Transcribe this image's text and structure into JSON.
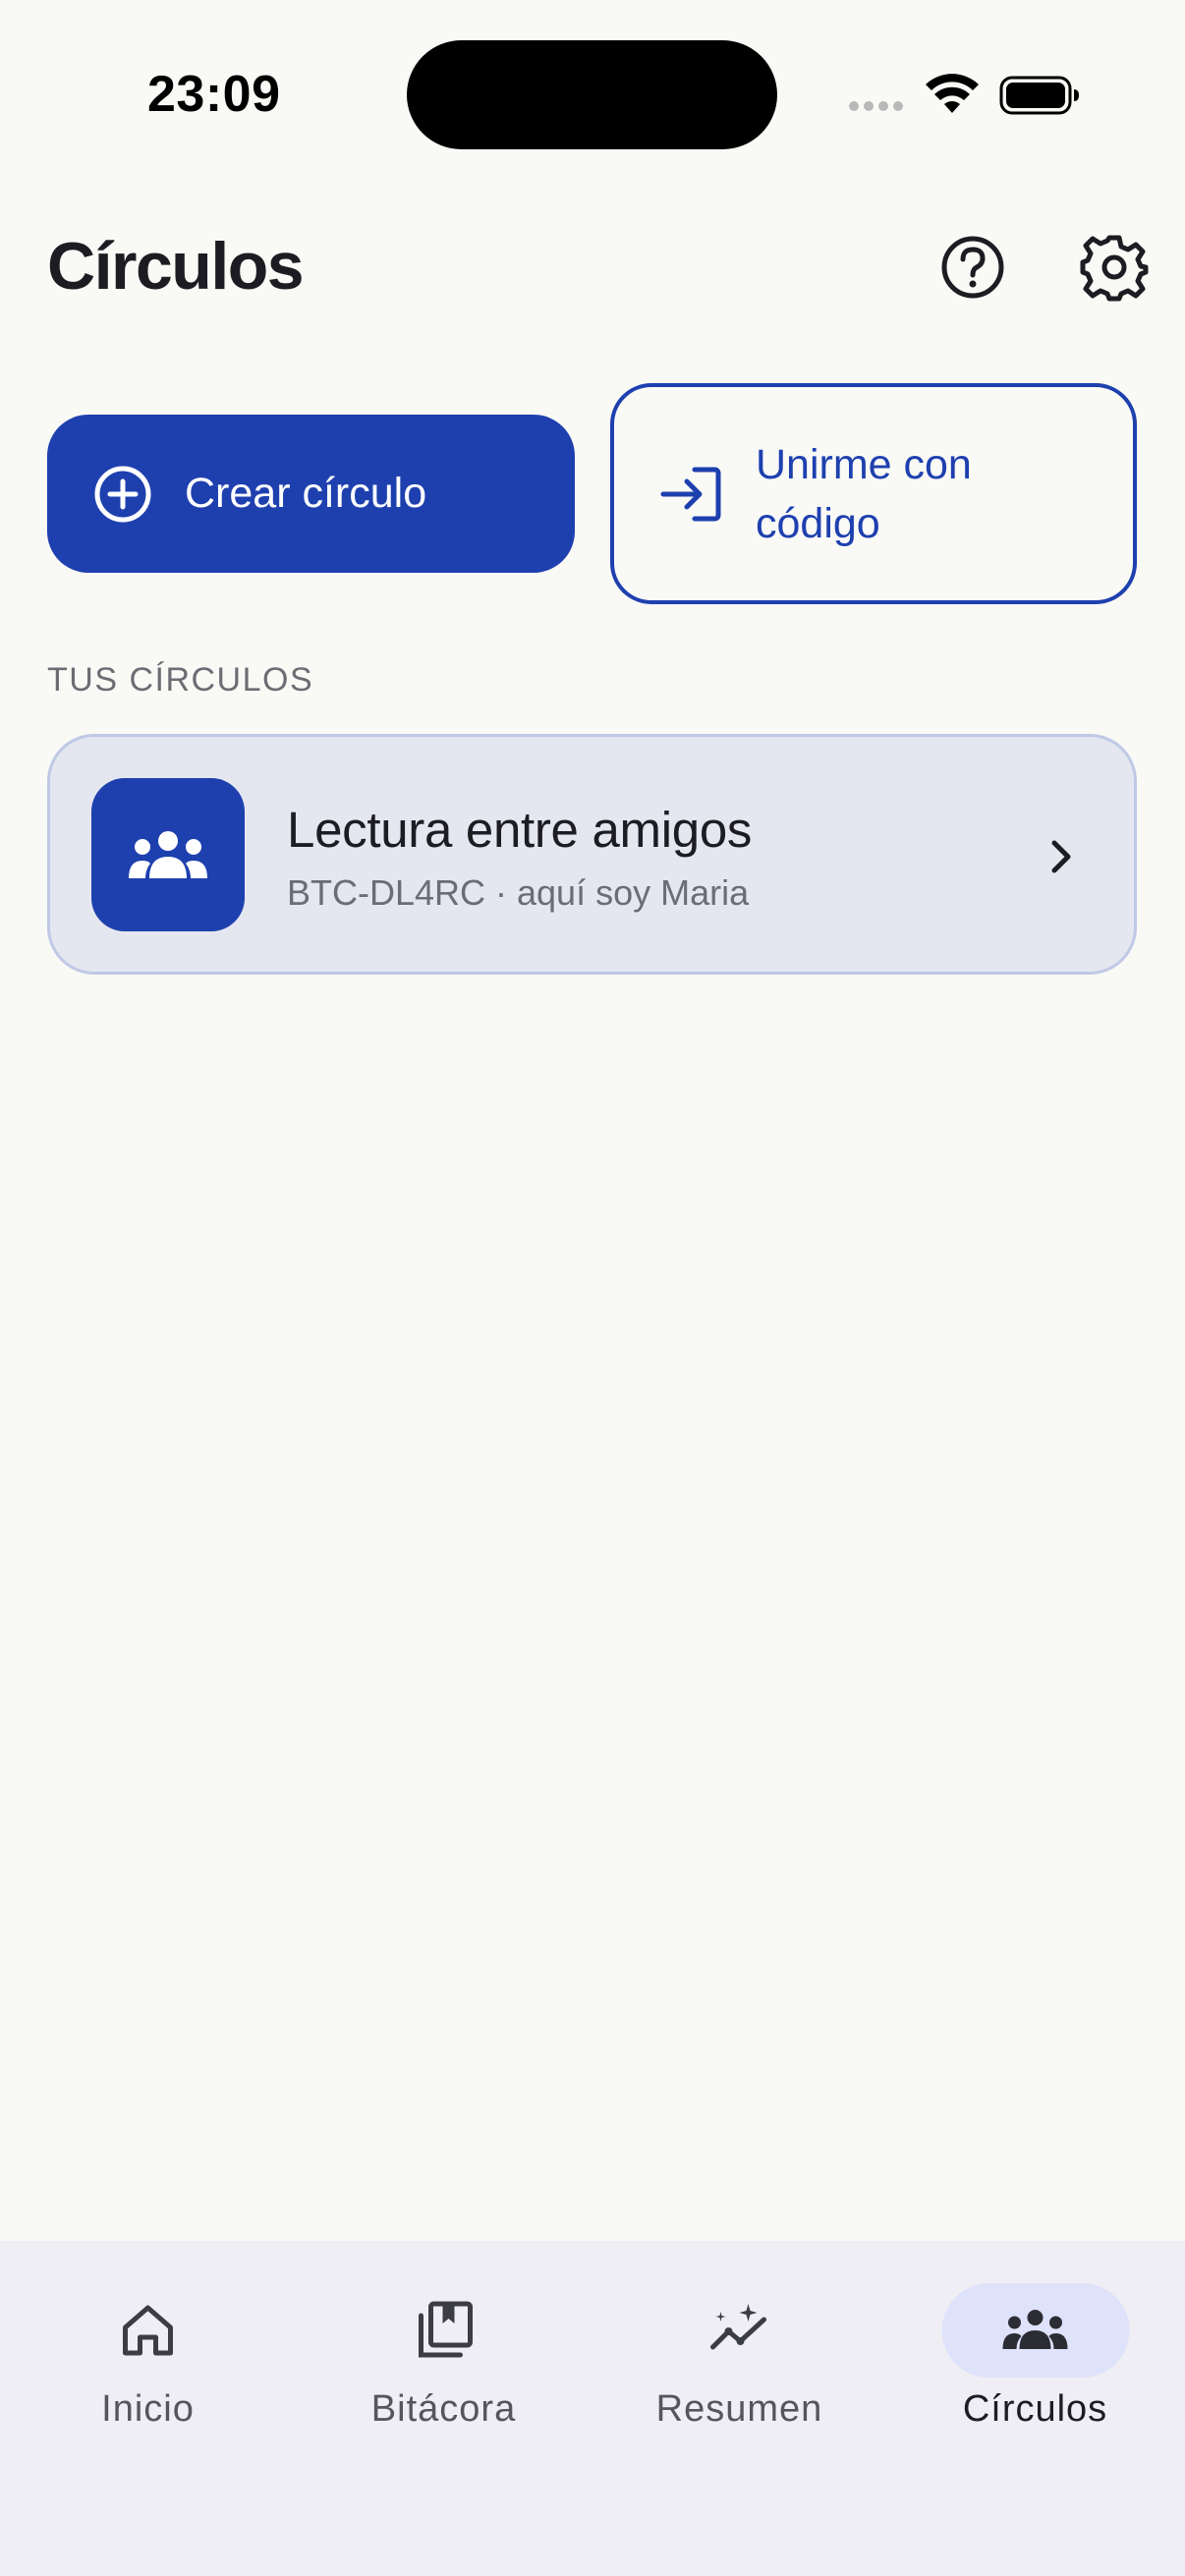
{
  "status_bar": {
    "time": "23:09"
  },
  "header": {
    "title": "Círculos",
    "help_icon": "help-circle-icon",
    "settings_icon": "gear-icon"
  },
  "actions": {
    "create_label": "Crear círculo",
    "create_icon": "plus-circle-icon",
    "join_label": "Unirme con código",
    "join_icon": "login-arrow-icon"
  },
  "section": {
    "label": "TUS CÍRCULOS"
  },
  "circles": [
    {
      "name": "Lectura entre amigos",
      "meta": "BTC-DL4RC · aquí soy Maria",
      "icon": "group-icon"
    }
  ],
  "bottom_nav": {
    "items": [
      {
        "label": "Inicio",
        "icon": "home-icon",
        "active": false
      },
      {
        "label": "Bitácora",
        "icon": "bookmark-stack-icon",
        "active": false
      },
      {
        "label": "Resumen",
        "icon": "sparkle-chart-icon",
        "active": false
      },
      {
        "label": "Círculos",
        "icon": "group-icon",
        "active": true
      }
    ]
  },
  "colors": {
    "accent": "#1e40af",
    "background": "#f9f9f6",
    "card": "#e4e6f0",
    "nav_background": "#eeeef4",
    "nav_active_pill": "#dfe2fb"
  }
}
